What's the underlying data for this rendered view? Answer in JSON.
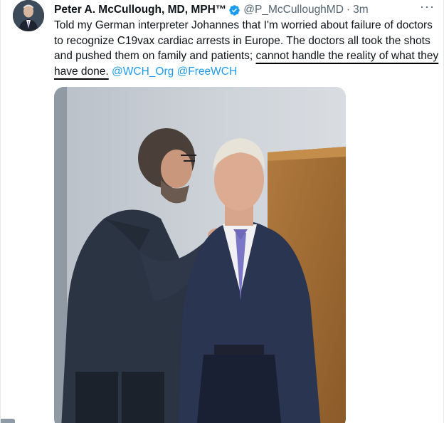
{
  "author": {
    "name": "Peter A. McCullough, MD, MPH™",
    "handle": "@P_McCulloughMD",
    "separator": "·",
    "time": "3m"
  },
  "tweet": {
    "text_part1": "Told my German interpreter Johannes that I'm worried about failure of doctors to recognize C19vax cardiac arrests in Europe.  The doctors all took the shots and pushed them on family and patients; ",
    "text_underlined": "cannot handle the reality of what they have done.",
    "mention_1": "@WCH_Org",
    "mention_2": "@FreeWCH"
  },
  "menu": {
    "more_label": "···"
  },
  "icons": {
    "verified": "verified-badge-icon",
    "more": "more-options-icon"
  },
  "colors": {
    "link": "#1d9bf0",
    "verified": "#1d9bf0",
    "secondary_text": "#536471"
  }
}
